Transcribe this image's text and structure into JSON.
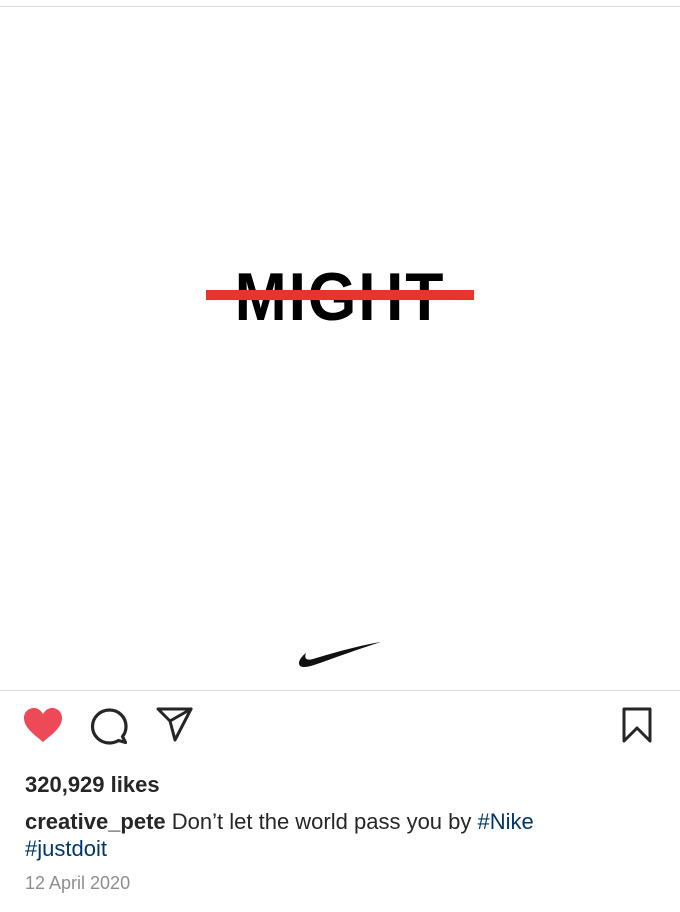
{
  "post": {
    "image": {
      "headline_text": "MIGHT",
      "strike_color": "#e8342a",
      "logo": "nike-swoosh-logo"
    },
    "actions": {
      "like_icon": "heart-filled-icon",
      "like_color": "#ed4956",
      "comment_icon": "comment-bubble-icon",
      "share_icon": "paper-plane-icon",
      "save_icon": "bookmark-icon"
    },
    "likes_text": "320,929 likes",
    "caption": {
      "username": "creative_pete",
      "text": "Don’t let the world pass you by",
      "hashtags": [
        "#Nike",
        "#justdoit"
      ]
    },
    "date": "12 April 2020"
  }
}
